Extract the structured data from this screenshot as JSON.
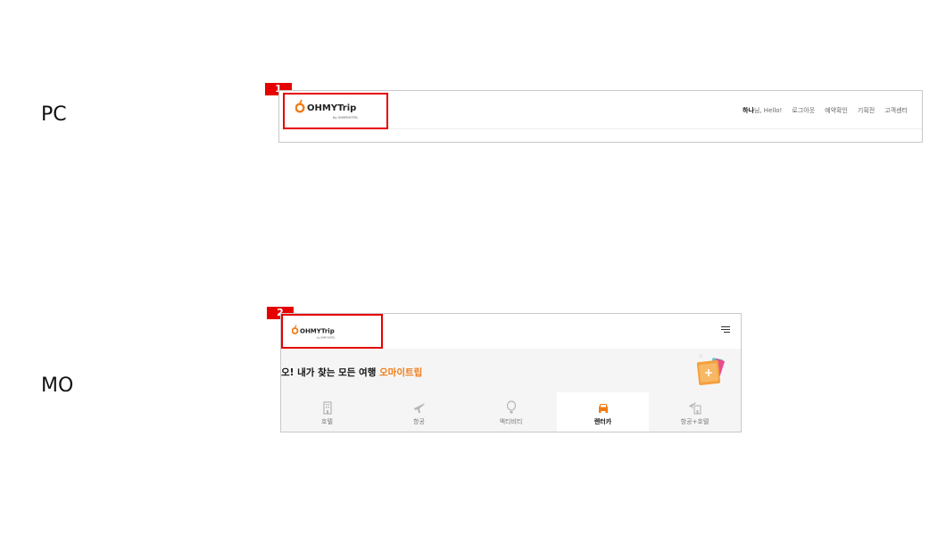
{
  "labels": {
    "pc": "PC",
    "mo": "MO"
  },
  "badges": {
    "pc": "1",
    "mo": "2"
  },
  "brand": {
    "name": "OHMYTrip",
    "sub": "by OHMYHOTEL",
    "accent": "#f07b16",
    "highlight": "#e60000"
  },
  "pc": {
    "nav": {
      "greeting_name": "하나",
      "greeting_rest": "님, Hello!",
      "items": [
        "로그아웃",
        "예약확인",
        "기획전",
        "고객센터"
      ]
    }
  },
  "mo": {
    "menu_icon": "hamburger-menu-icon",
    "tagline_prefix": "오! 내가 찾는 모든 여행 ",
    "tagline_brand": "오마이트립",
    "tabs": [
      {
        "label": "호텔",
        "icon": "hotel-icon",
        "active": false
      },
      {
        "label": "항공",
        "icon": "airplane-icon",
        "active": false
      },
      {
        "label": "액티비티",
        "icon": "balloon-icon",
        "active": false
      },
      {
        "label": "렌터카",
        "icon": "car-icon",
        "active": true
      },
      {
        "label": "항공+호텔",
        "icon": "flight-hotel-icon",
        "active": false
      }
    ]
  }
}
